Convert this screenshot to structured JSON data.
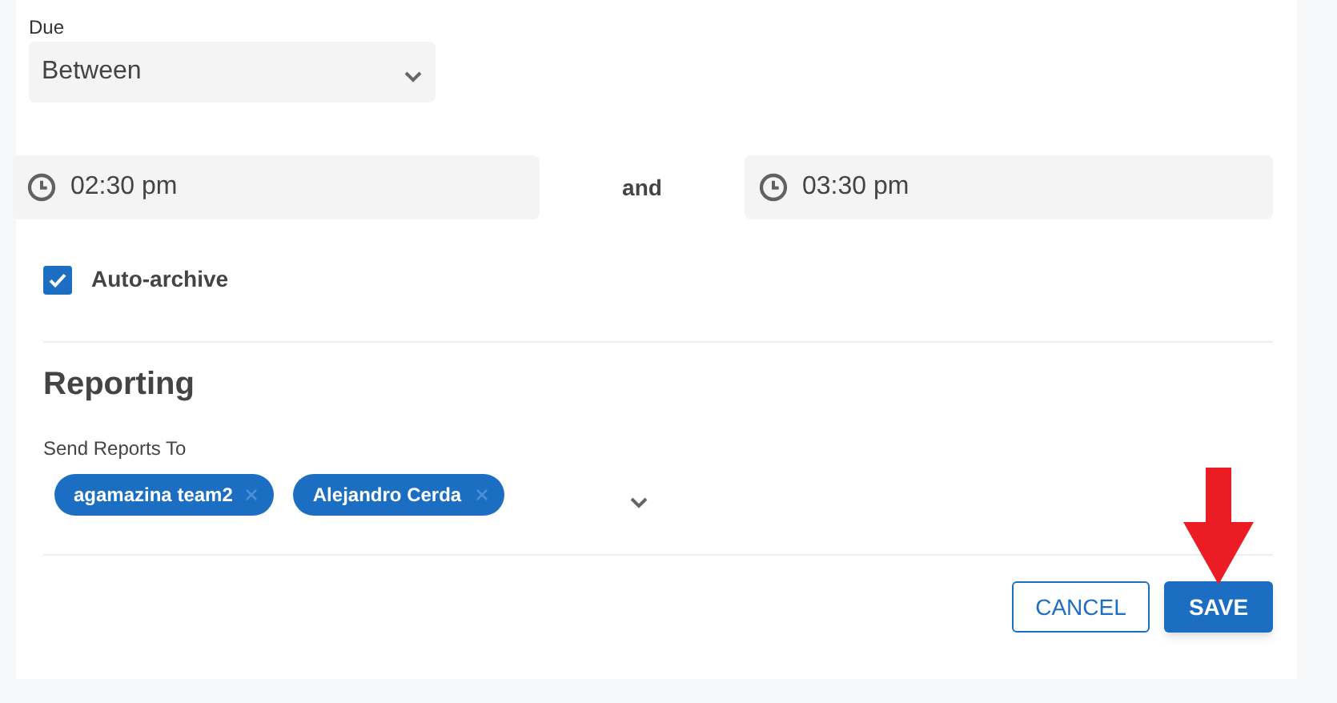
{
  "due": {
    "label": "Due",
    "value": "Between"
  },
  "time_from": {
    "value": "02:30 pm"
  },
  "connector": "and",
  "time_to": {
    "value": "03:30 pm"
  },
  "auto_archive": {
    "label": "Auto-archive",
    "checked": true
  },
  "reporting": {
    "title": "Reporting",
    "field_label": "Send Reports To",
    "recipients": [
      {
        "name": "agamazina team2"
      },
      {
        "name": "Alejandro Cerda"
      }
    ]
  },
  "buttons": [
    {
      "label": "CANCEL",
      "kind": "outlined"
    },
    {
      "label": "SAVE",
      "kind": "primary"
    }
  ]
}
